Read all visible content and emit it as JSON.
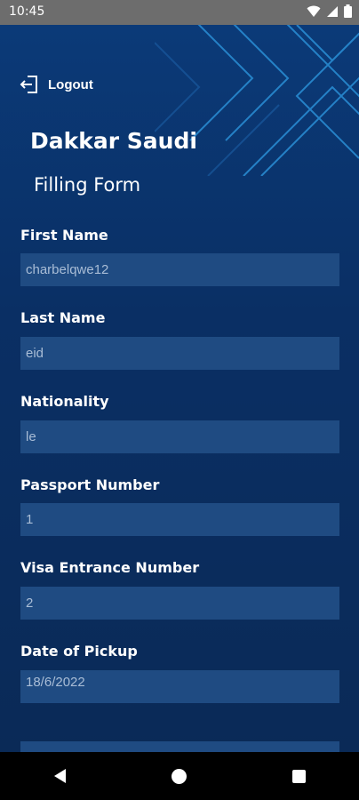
{
  "status": {
    "time": "10:45"
  },
  "header": {
    "logout_label": "Logout",
    "brand": "Dakkar Saudi",
    "subtitle": "Filling Form"
  },
  "form": {
    "fields": [
      {
        "label": "First Name",
        "value": "charbelqwe12"
      },
      {
        "label": "Last Name",
        "value": "eid"
      },
      {
        "label": "Nationality",
        "value": "le"
      },
      {
        "label": "Passport Number",
        "value": "1"
      },
      {
        "label": "Visa Entrance Number",
        "value": "2"
      },
      {
        "label": "Date of Pickup",
        "value": "18/6/2022"
      }
    ]
  },
  "colors": {
    "background": "#0a2a57",
    "field": "#1f4b82",
    "accent_lines": "#2a8fd6"
  },
  "icons": {
    "logout": "logout-icon",
    "wifi": "wifi-icon",
    "signal": "signal-icon",
    "battery": "battery-icon"
  }
}
